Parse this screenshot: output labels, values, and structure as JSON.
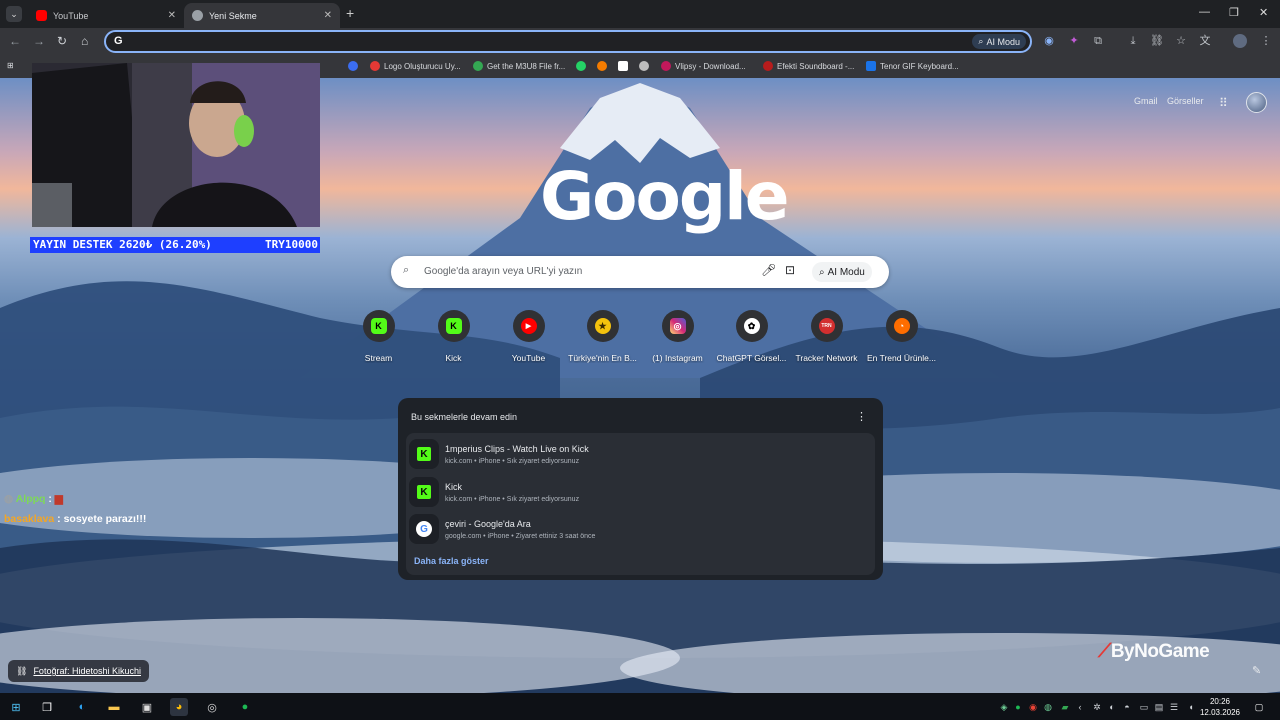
{
  "browser": {
    "tabs": [
      {
        "title": "YouTube",
        "favicon": "youtube-icon",
        "active": false
      },
      {
        "title": "Yeni Sekme",
        "favicon": "chrome-icon",
        "active": true
      }
    ],
    "omnibox": {
      "value": "",
      "ai_mode_label": "AI Modu"
    }
  },
  "bookmarks": [
    {
      "label": "Logo Oluşturucu Uy...",
      "color": "#e53935"
    },
    {
      "label": "Get the M3U8 File fr...",
      "color": "#34a853"
    },
    {
      "label": "Vlipsy - Download...",
      "color": "#c2185b"
    },
    {
      "label": "Efekti Soundboard -...",
      "color": "#b71c1c"
    },
    {
      "label": "Tenor GIF Keyboard...",
      "color": "#1a73e8"
    }
  ],
  "google": {
    "links": {
      "gmail": "Gmail",
      "images": "Görseller"
    },
    "logo": "Google",
    "search_placeholder": "Google'da arayın veya URL'yi yazın",
    "ai_mode_label": "AI Modu"
  },
  "shortcuts": [
    {
      "label": "Stream",
      "icon": "kick-icon",
      "color": "#53fc18",
      "glyph": "K"
    },
    {
      "label": "Kick",
      "icon": "kick-icon",
      "color": "#53fc18",
      "glyph": "K"
    },
    {
      "label": "YouTube",
      "icon": "youtube-icon",
      "color": "#ff0000",
      "glyph": "▶"
    },
    {
      "label": "Türkiye'nin En B...",
      "icon": "yellow-emblem-icon",
      "color": "#f4c20d",
      "glyph": "★"
    },
    {
      "label": "(1) Instagram",
      "icon": "instagram-icon",
      "color": "#d62976",
      "glyph": "◎"
    },
    {
      "label": "ChatGPT Görsel...",
      "icon": "chatgpt-icon",
      "color": "#ffffff",
      "glyph": "✿"
    },
    {
      "label": "Tracker Network",
      "icon": "trn-icon",
      "color": "#d32f2f",
      "glyph": "TRN"
    },
    {
      "label": "En Trend Ürünle...",
      "icon": "trend-icon",
      "color": "#ff6d00",
      "glyph": "◔"
    }
  ],
  "continue_card": {
    "title": "Bu sekmelerle devam edin",
    "items": [
      {
        "title": "1mperius Clips - Watch Live on Kick",
        "subtitle": "kick.com • iPhone • Sık ziyaret ediyorsunuz",
        "icon": "kick"
      },
      {
        "title": "Kick",
        "subtitle": "kick.com • iPhone • Sık ziyaret ediyorsunuz",
        "icon": "kick"
      },
      {
        "title": "çeviri - Google'da Ara",
        "subtitle": "google.com • iPhone • Ziyaret ettiniz 3 saat önce",
        "icon": "google"
      }
    ],
    "more_label": "Daha fazla göster"
  },
  "overlay": {
    "donation_left": "YAYIN DESTEK 2620₺ (26.20%)",
    "donation_right": "TRY10000",
    "chat": [
      {
        "user": "Alppq",
        "message": "",
        "color": "#7ed957"
      },
      {
        "user": "basaklava",
        "message": "sosyete parazı!!!",
        "color": "#f5a623"
      }
    ],
    "photo_credit": "Fotoğraf: Hidetoshi Kikuchi",
    "watermark": "ByNoGame"
  },
  "taskbar": {
    "time": "20:26",
    "date": "12.03.2026"
  }
}
